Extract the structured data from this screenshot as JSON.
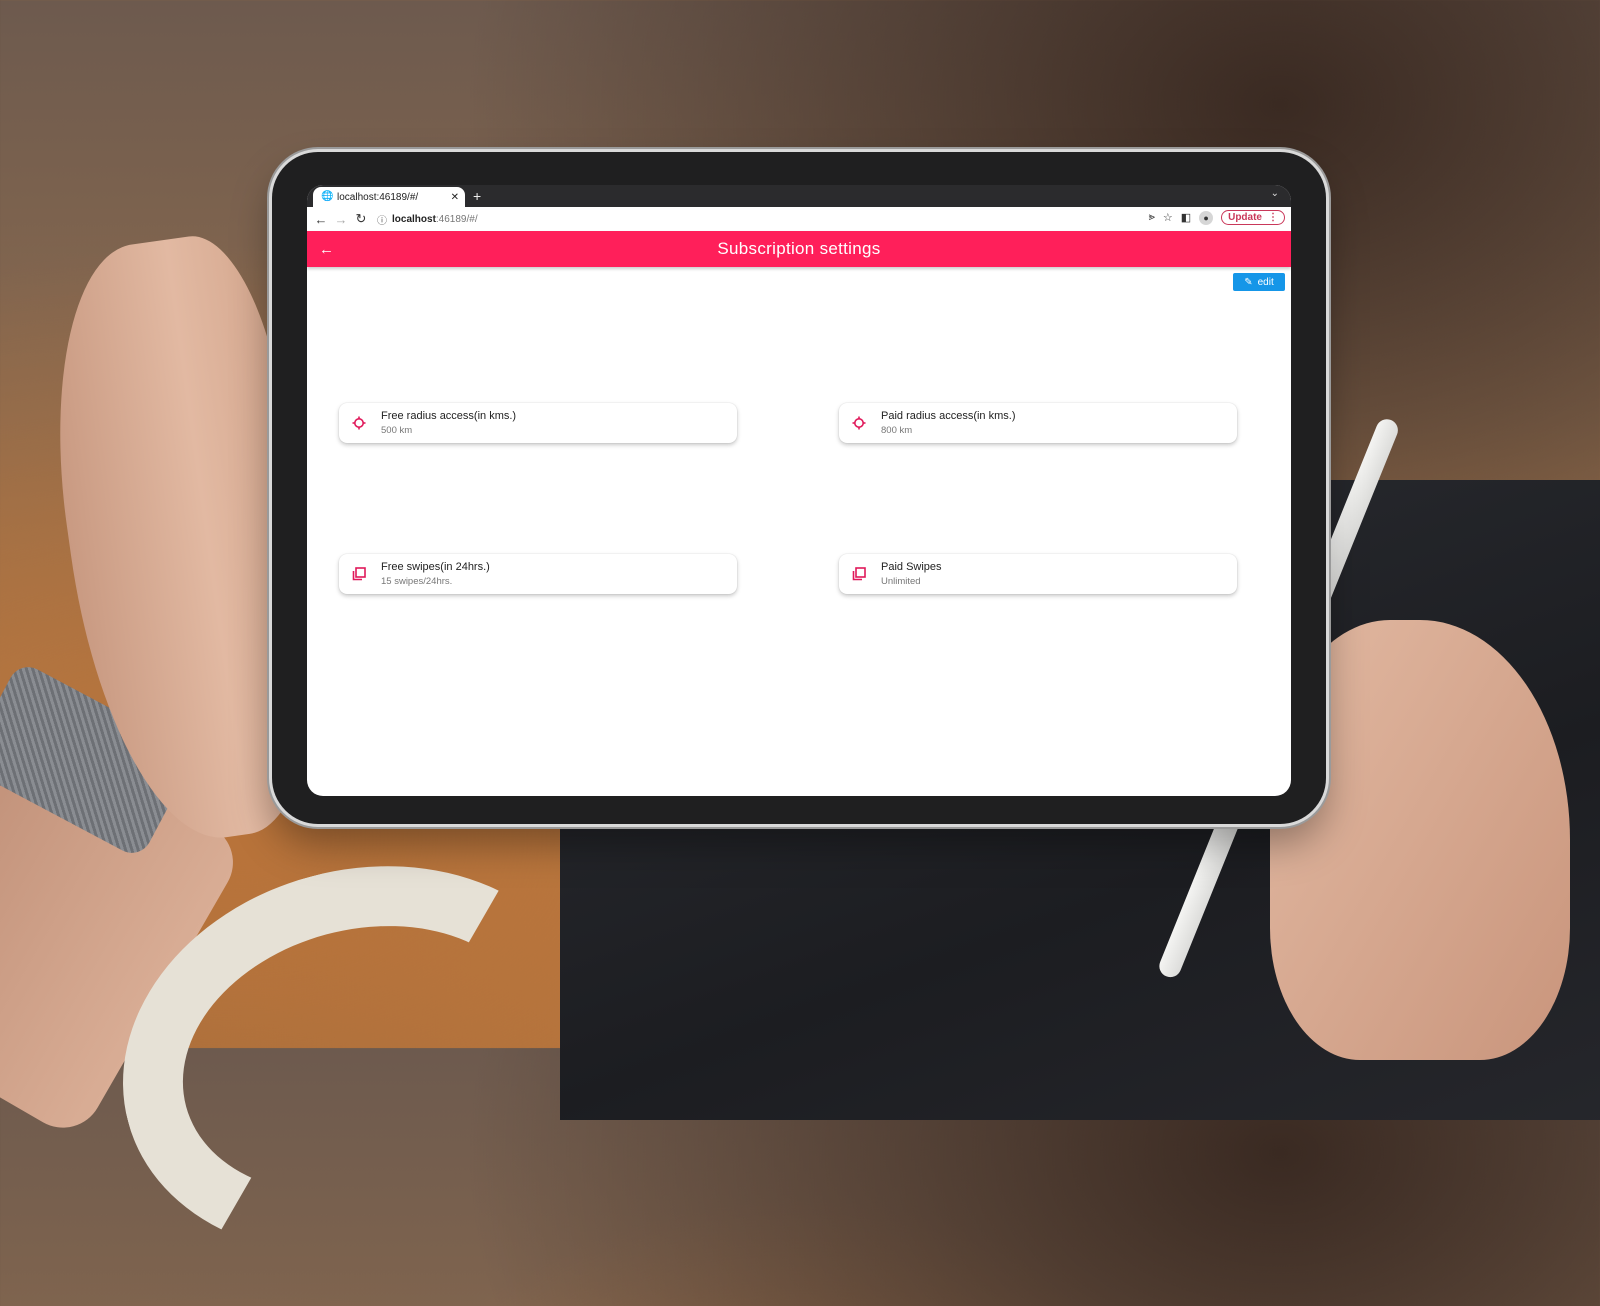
{
  "browser": {
    "tab_title": "localhost:46189/#/",
    "url_host": "localhost",
    "url_path": ":46189/#/",
    "update_label": "Update"
  },
  "app": {
    "title": "Subscription settings",
    "edit_label": "edit",
    "accent_color": "#ff1f5a",
    "edit_button_color": "#1596e8"
  },
  "settings": [
    {
      "label": "Free radius access(in kms.)",
      "value": "500 km",
      "icon": "gps-target-icon"
    },
    {
      "label": "Paid radius access(in kms.)",
      "value": "800 km",
      "icon": "gps-target-icon"
    },
    {
      "label": "Free swipes(in 24hrs.)",
      "value": "15 swipes/24hrs.",
      "icon": "library-stack-icon"
    },
    {
      "label": "Paid Swipes",
      "value": "Unlimited",
      "icon": "library-stack-icon"
    }
  ]
}
